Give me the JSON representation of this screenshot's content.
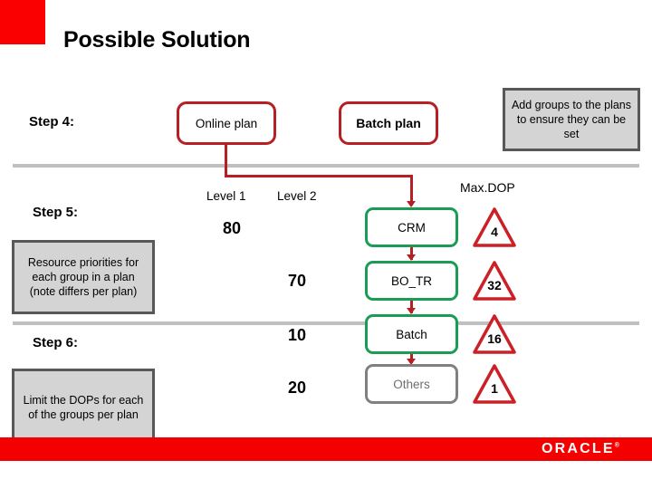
{
  "slide": {
    "title": "Possible Solution",
    "accent_red": "#fa0000",
    "box_red": "#b61f24",
    "box_green": "#1a9c54",
    "box_grey": "#808080",
    "callout_fill": "#d4d4d4",
    "callout_border": "#585858"
  },
  "steps": [
    {
      "label": "Step 4:"
    },
    {
      "label": "Step 5:"
    },
    {
      "label": "Step 6:"
    }
  ],
  "callouts": {
    "add_groups": "Add groups to the plans to ensure they can be set",
    "resource_priorities": "Resource priorities for each group in a plan (note differs per plan)",
    "limit_dops": "Limit the DOPs for each of the groups per plan"
  },
  "plans": [
    {
      "name": "Online plan"
    },
    {
      "name": "Batch plan"
    }
  ],
  "columns": {
    "level_1": "Level 1",
    "level_2": "Level 2",
    "maxdop": "Max.DOP"
  },
  "rows": [
    {
      "group": "CRM",
      "level_1": "80",
      "level_2": "",
      "maxdop": "4",
      "state": "active"
    },
    {
      "group": "BO_TR",
      "level_1": "",
      "level_2": "70",
      "maxdop": "32",
      "state": "active"
    },
    {
      "group": "Batch",
      "level_1": "",
      "level_2": "10",
      "maxdop": "16",
      "state": "active"
    },
    {
      "group": "Others",
      "level_1": "",
      "level_2": "20",
      "maxdop": "1",
      "state": "disabled"
    }
  ],
  "footer": {
    "logo": "ORACLE",
    "trademark": "®"
  }
}
